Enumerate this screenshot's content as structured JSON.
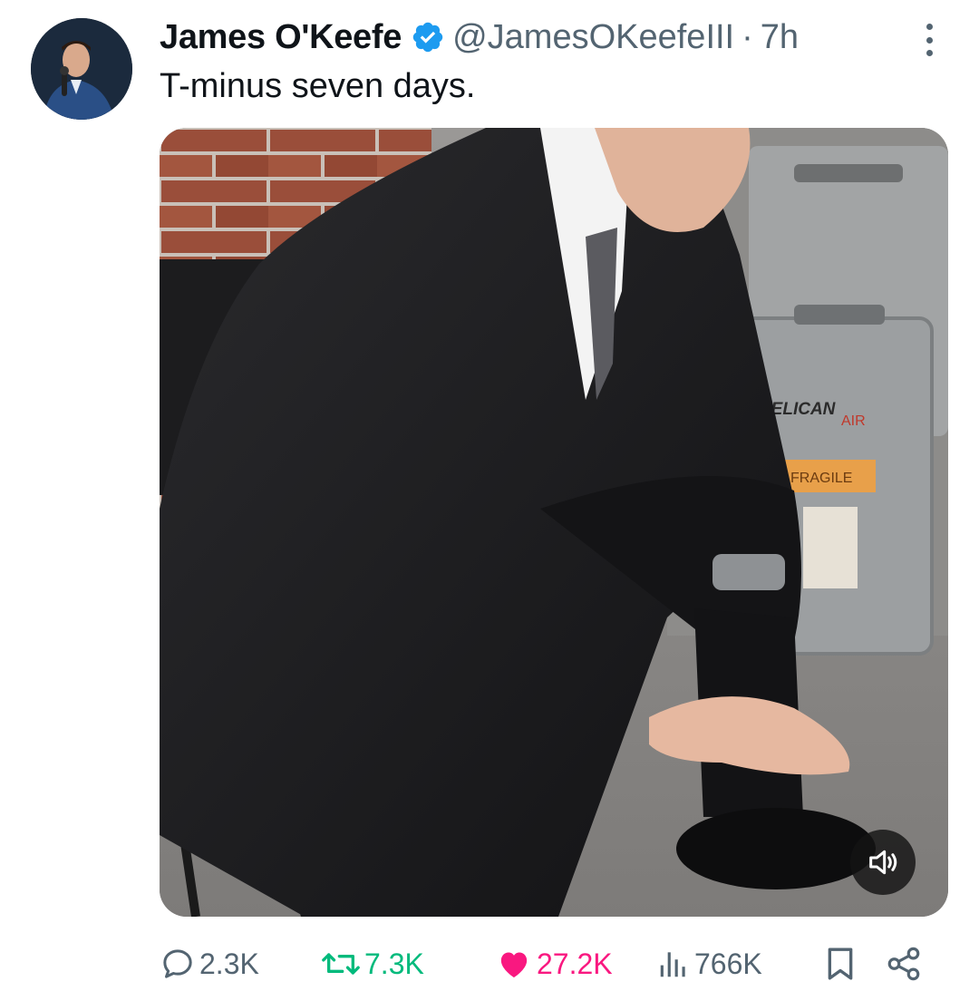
{
  "tweet": {
    "author_name": "James O'Keefe",
    "handle": "@JamesOKeefeIII",
    "separator": "·",
    "time": "7h",
    "text": "T-minus seven days.",
    "verified_color": "#1d9bf0"
  },
  "media": {
    "case_brand": "PELICAN",
    "case_model": "AIR",
    "case_sticker": "FRAGILE",
    "sound_icon": "speaker-icon"
  },
  "actions": {
    "replies": "2.3K",
    "retweets": "7.3K",
    "likes": "27.2K",
    "views": "766K"
  },
  "colors": {
    "text_primary": "#0f1419",
    "text_secondary": "#536471",
    "retweet": "#00ba7c",
    "like": "#f91880"
  }
}
